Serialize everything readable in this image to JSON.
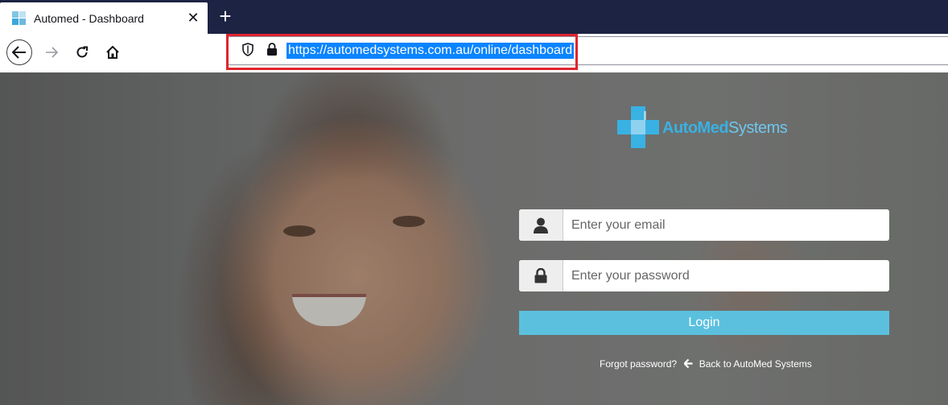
{
  "browser": {
    "tab": {
      "title": "Automed - Dashboard",
      "close_glyph": "✕"
    },
    "new_tab_glyph": "+",
    "url": "https://automedsystems.com.au/online/dashboard",
    "icons": [
      "back-icon",
      "forward-icon",
      "reload-icon",
      "home-icon",
      "shield-icon",
      "lock-icon"
    ]
  },
  "brand": {
    "name_bold": "AutoMed",
    "name_light": "Systems",
    "color": "#39b1e3"
  },
  "login_form": {
    "email_placeholder": "Enter your email",
    "password_placeholder": "Enter your password",
    "login_label": "Login",
    "button_color": "#5bc0de",
    "forgot_label": "Forgot password?",
    "back_label": "Back to AutoMed Systems"
  },
  "annotation": {
    "highlight_color": "#e0242f"
  }
}
